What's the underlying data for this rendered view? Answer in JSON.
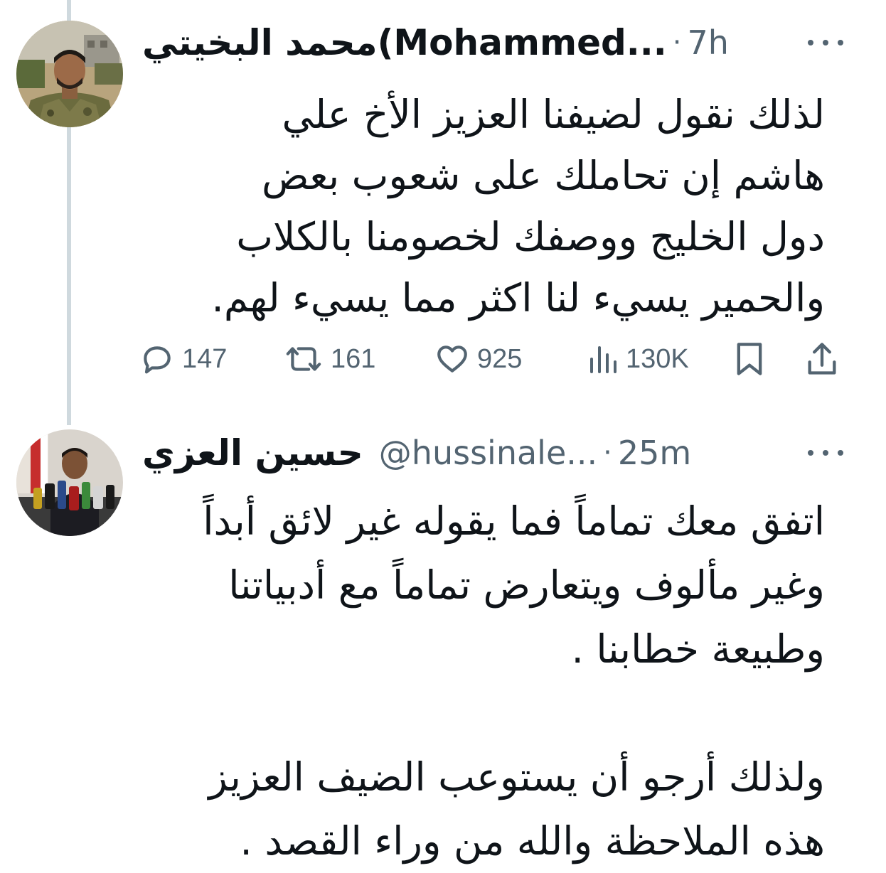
{
  "tweets": [
    {
      "author_name": "محمد البخيتي(Mohammed...",
      "time_dot": "·",
      "time": "7h",
      "avatar_icon": "profile-photo-man-in-camouflage",
      "lines": [
        "لذلك نقول لضيفنا العزيز الأخ علي",
        "هاشم إن تحاملك على شعوب بعض",
        "دول الخليج ووصفك لخصومنا بالكلاب",
        "والحمير يسيء لنا اكثر مما يسيء لهم."
      ],
      "actions": {
        "replies": "147",
        "retweets": "161",
        "likes": "925",
        "views": "130K"
      }
    },
    {
      "author_name": "حسين العزي",
      "handle": "@hussinale...",
      "time_dot": "·",
      "time": "25m",
      "avatar_icon": "profile-photo-press-conference",
      "lines": [
        "اتفق معك تماماً فما يقوله غير لائق أبداً",
        "وغير مألوف ويتعارض تماماً مع أدبياتنا",
        "وطبيعة خطابنا .",
        "",
        "ولذلك أرجو أن يستوعب الضيف العزيز",
        "هذه الملاحظة والله من وراء القصد ."
      ]
    }
  ],
  "icons": {
    "reply": "reply-icon",
    "retweet": "retweet-icon",
    "like": "heart-icon",
    "views": "views-icon",
    "bookmark": "bookmark-icon",
    "share": "share-icon",
    "more": "more-icon"
  },
  "colors": {
    "text": "#0f1419",
    "secondary": "#536471",
    "thread_line": "#cfd9de"
  }
}
